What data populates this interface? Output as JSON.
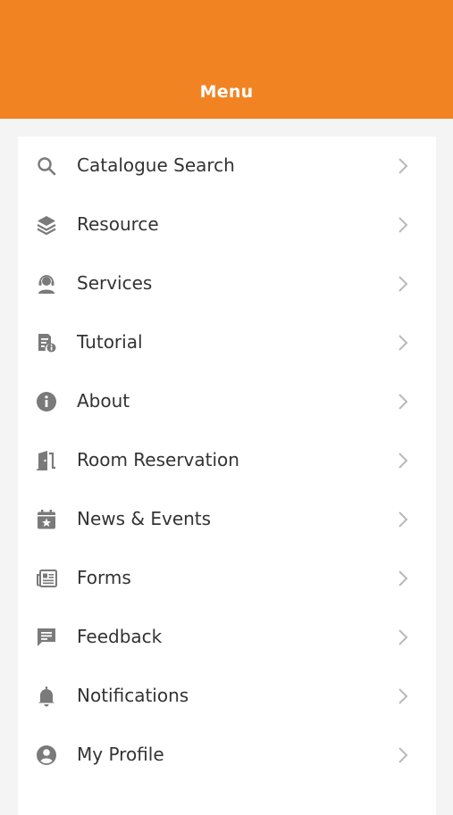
{
  "header": {
    "title": "Menu"
  },
  "theme": {
    "accent": "#f28322",
    "icon_color": "#7a7a7a",
    "chevron_color": "#b9b9b9",
    "text_color": "#333333"
  },
  "menu": {
    "items": [
      {
        "label": "Catalogue Search",
        "icon": "search-icon"
      },
      {
        "label": "Resource",
        "icon": "layers-icon"
      },
      {
        "label": "Services",
        "icon": "support-agent-icon"
      },
      {
        "label": "Tutorial",
        "icon": "document-info-icon"
      },
      {
        "label": "About",
        "icon": "info-icon"
      },
      {
        "label": "Room Reservation",
        "icon": "door-icon"
      },
      {
        "label": "News & Events",
        "icon": "calendar-star-icon"
      },
      {
        "label": "Forms",
        "icon": "newspaper-icon"
      },
      {
        "label": "Feedback",
        "icon": "chat-feedback-icon"
      },
      {
        "label": "Notifications",
        "icon": "bell-icon"
      },
      {
        "label": "My Profile",
        "icon": "account-circle-icon"
      }
    ]
  }
}
